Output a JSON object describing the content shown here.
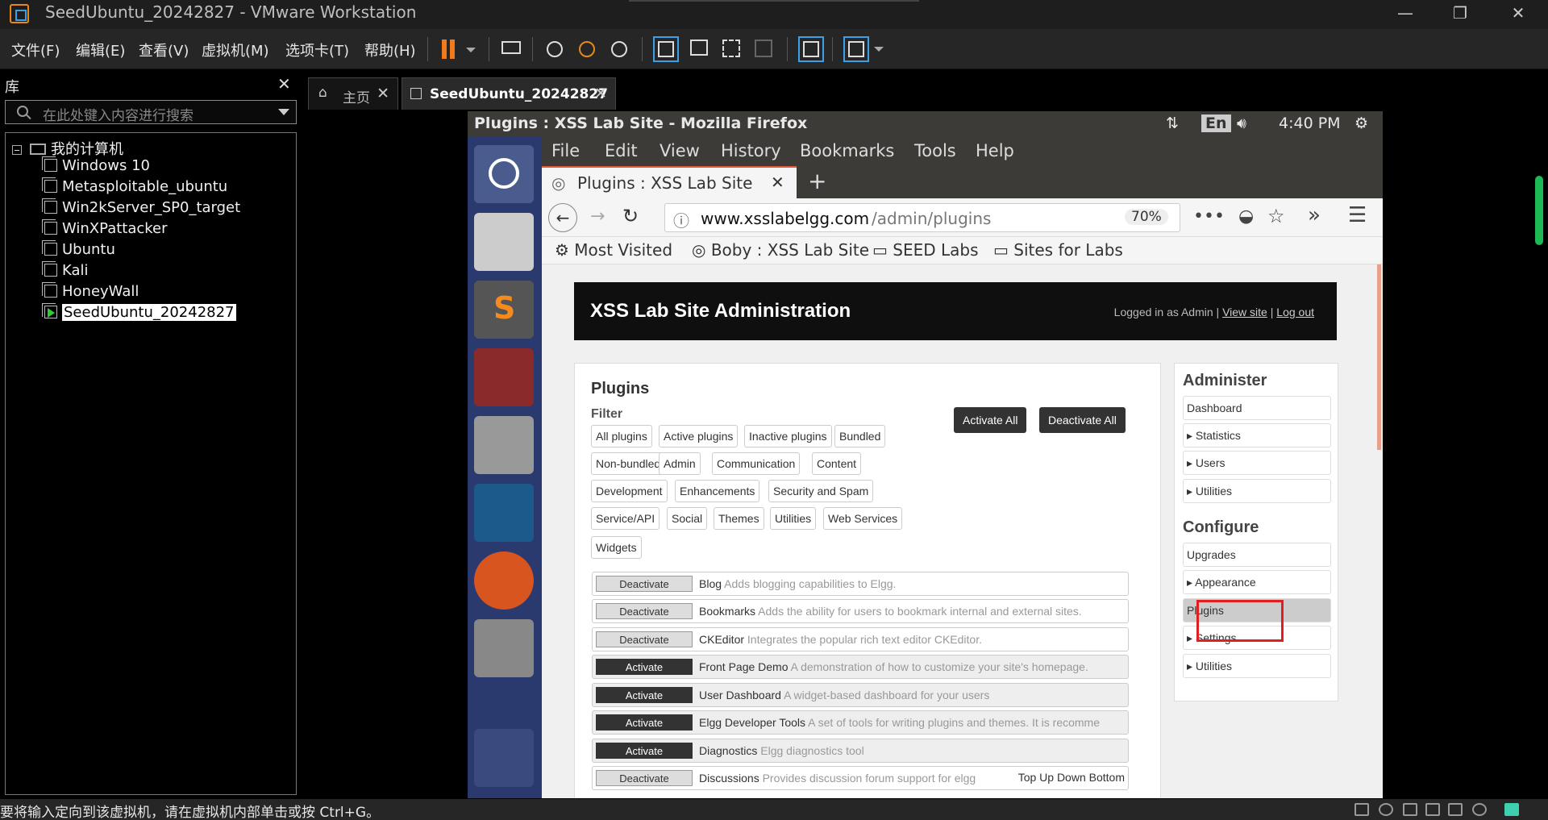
{
  "window": {
    "title": "SeedUbuntu_20242827 - VMware Workstation"
  },
  "menu": [
    "文件(F)",
    "编辑(E)",
    "查看(V)",
    "虚拟机(M)",
    "选项卡(T)",
    "帮助(H)"
  ],
  "library": {
    "title": "库",
    "search_placeholder": "在此处键入内容进行搜索",
    "root": "我的计算机",
    "items": [
      "Windows 10",
      "Metasploitable_ubuntu",
      "Win2kServer_SP0_target",
      "WinXPattacker",
      "Ubuntu",
      "Kali",
      "HoneyWall",
      "SeedUbuntu_20242827"
    ],
    "selected": "SeedUbuntu_20242827"
  },
  "vm_tabs": [
    {
      "label": "主页"
    },
    {
      "label": "SeedUbuntu_20242827"
    }
  ],
  "ubuntu_bar": {
    "window_title": "Plugins : XSS Lab Site - Mozilla Firefox",
    "lang": "En",
    "time": "4:40 PM"
  },
  "firefox": {
    "menu": [
      "File",
      "Edit",
      "View",
      "History",
      "Bookmarks",
      "Tools",
      "Help"
    ],
    "tab_title": "Plugins : XSS Lab Site",
    "url_domain": "www.xsslabelgg.com",
    "url_path": "/admin/plugins",
    "zoom": "70%",
    "bookmarks": [
      "Most Visited",
      "Boby : XSS Lab Site",
      "SEED Labs",
      "Sites for Labs"
    ]
  },
  "site": {
    "header_title": "XSS Lab Site Administration",
    "logged_in": "Logged in as Admin",
    "view_site": "View site",
    "log_out": "Log out",
    "sep": "|",
    "plugins_title": "Plugins",
    "filter_label": "Filter",
    "activate_all": "Activate All",
    "deactivate_all": "Deactivate All",
    "filters": [
      "All plugins",
      "Active plugins",
      "Inactive plugins",
      "Bundled",
      "Non-bundled",
      "Admin",
      "Communication",
      "Content",
      "Development",
      "Enhancements",
      "Security and Spam",
      "Service/API",
      "Social",
      "Themes",
      "Utilities",
      "Web Services",
      "Widgets"
    ],
    "plugins": [
      {
        "action": "Deactivate",
        "name": "Blog",
        "desc": "Adds blogging capabilities to Elgg.",
        "active": true
      },
      {
        "action": "Deactivate",
        "name": "Bookmarks",
        "desc": "Adds the ability for users to bookmark internal and external sites.",
        "active": true
      },
      {
        "action": "Deactivate",
        "name": "CKEditor",
        "desc": "Integrates the popular rich text editor CKEditor.",
        "active": true
      },
      {
        "action": "Activate",
        "name": "Front Page Demo",
        "desc": "A demonstration of how to customize your site's homepage.",
        "active": false
      },
      {
        "action": "Activate",
        "name": "User Dashboard",
        "desc": "A widget-based dashboard for your users",
        "active": false
      },
      {
        "action": "Activate",
        "name": "Elgg Developer Tools",
        "desc": "A set of tools for writing plugins and themes. It is recomme",
        "active": false
      },
      {
        "action": "Activate",
        "name": "Diagnostics",
        "desc": "Elgg diagnostics tool",
        "active": false
      },
      {
        "action": "Deactivate",
        "name": "Discussions",
        "desc": "Provides discussion forum support for elgg",
        "active": true
      }
    ],
    "scroll_links": "Top Up Down Bottom",
    "administer_title": "Administer",
    "administer": [
      "Dashboard",
      "▸ Statistics",
      "▸ Users",
      "▸ Utilities"
    ],
    "configure_title": "Configure",
    "configure": [
      "Upgrades",
      "▸ Appearance",
      "Plugins",
      "▸ Settings",
      "▸ Utilities"
    ]
  },
  "status": {
    "text": "要将输入定向到该虚拟机，请在虚拟机内部单击或按 Ctrl+G。"
  },
  "colors": {
    "highlight": "#e02020",
    "launcher": "#2a3a6e",
    "accent_tab": "#e25b3c"
  }
}
